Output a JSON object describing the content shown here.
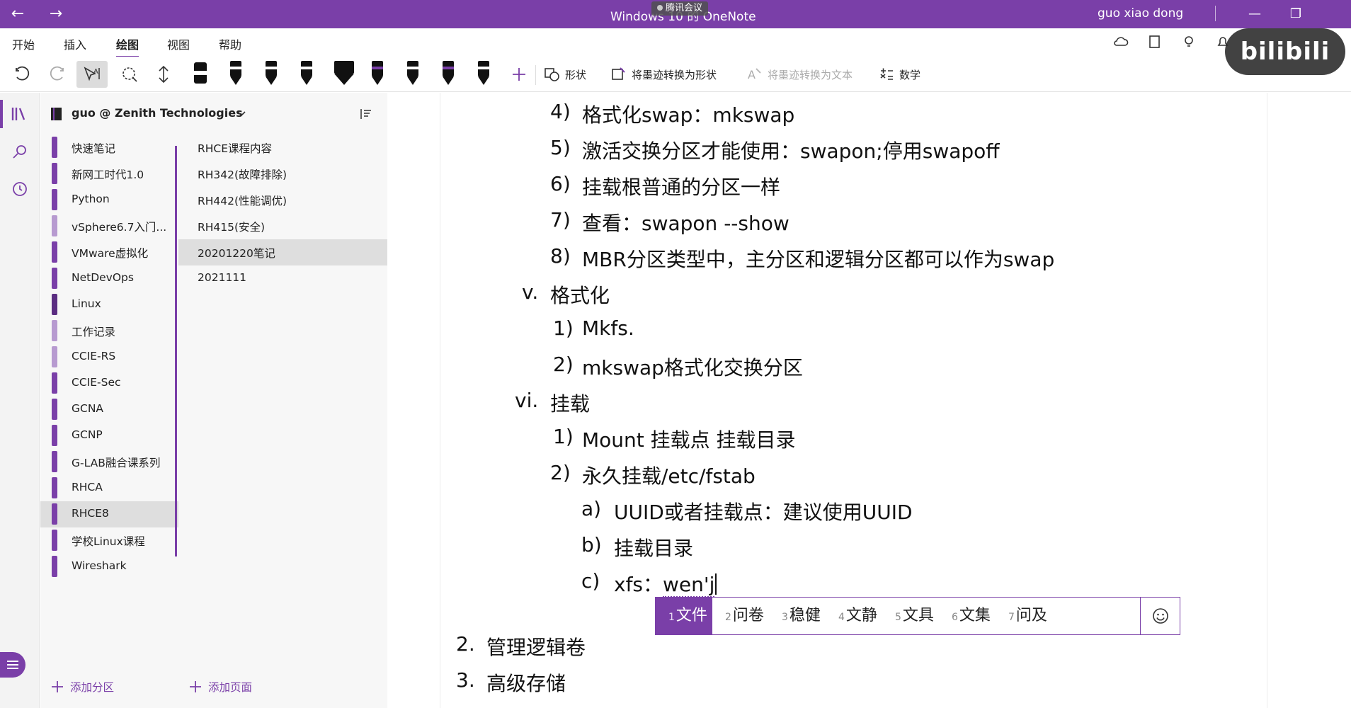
{
  "titlebar": {
    "title": "Windows 10 的 OneNote",
    "meeting_badge": "腾讯会议",
    "user": "guo xiao dong"
  },
  "menu": {
    "tabs": [
      "开始",
      "插入",
      "绘图",
      "视图",
      "帮助"
    ],
    "active_tab": "绘图"
  },
  "toolbar": {
    "shapes_label": "形状",
    "ink_to_shape_label": "将墨迹转换为形状",
    "ink_to_text_label": "将墨迹转换为文本",
    "math_label": "数学",
    "pen_band_colors": [
      "#ffffff",
      "#ffffff",
      "#ffffff",
      "#ffffff",
      "#7a3fa8",
      "#ffffff",
      "#7a3fa8",
      "#ffffff"
    ]
  },
  "notebook": {
    "name": "guo @ Zenith Technologies"
  },
  "sections": {
    "items": [
      {
        "label": "快速笔记",
        "color": "#7a3fa8"
      },
      {
        "label": "新网工时代1.0",
        "color": "#7a3fa8"
      },
      {
        "label": "Python",
        "color": "#7a3fa8"
      },
      {
        "label": "vSphere6.7入门...",
        "color": "#b79ad0"
      },
      {
        "label": "VMware虚拟化",
        "color": "#7a3fa8"
      },
      {
        "label": "NetDevOps",
        "color": "#7a3fa8"
      },
      {
        "label": "Linux",
        "color": "#5b2d82"
      },
      {
        "label": "工作记录",
        "color": "#b79ad0"
      },
      {
        "label": "CCIE-RS",
        "color": "#b79ad0"
      },
      {
        "label": "CCIE-Sec",
        "color": "#7a3fa8"
      },
      {
        "label": "GCNA",
        "color": "#7a3fa8"
      },
      {
        "label": "GCNP",
        "color": "#7a3fa8"
      },
      {
        "label": "G-LAB融合课系列",
        "color": "#7a3fa8"
      },
      {
        "label": "RHCA",
        "color": "#7a3fa8"
      },
      {
        "label": "RHCE8",
        "color": "#7a3fa8"
      },
      {
        "label": "学校Linux课程",
        "color": "#7a3fa8"
      },
      {
        "label": "Wireshark",
        "color": "#7a3fa8"
      }
    ],
    "active": "RHCE8",
    "add_label": "添加分区"
  },
  "pages": {
    "items": [
      "RHCE课程内容",
      "RH342(故障排除)",
      "RH442(性能调优)",
      "RH415(安全)",
      "20201220笔记",
      "2021111"
    ],
    "active": "20201220笔记",
    "add_label": "添加页面"
  },
  "note": {
    "lines": [
      {
        "num": "4)",
        "text": "格式化swap：mkswap"
      },
      {
        "num": "5)",
        "text": "激活交换分区才能使用：swapon;停用swapoff"
      },
      {
        "num": "6)",
        "text": "挂载根普通的分区一样"
      },
      {
        "num": "7)",
        "text": "查看：swapon --show"
      },
      {
        "num": "8)",
        "text": "MBR分区类型中，主分区和逻辑分区都可以作为swap"
      },
      {
        "num": "v.",
        "text": "格式化"
      },
      {
        "num": "1)",
        "text": "Mkfs."
      },
      {
        "num": "2)",
        "text": "mkswap格式化交换分区"
      },
      {
        "num": "vi.",
        "text": "挂载"
      },
      {
        "num": "1)",
        "text": "Mount 挂载点  挂载目录"
      },
      {
        "num": "2)",
        "text": "永久挂载/etc/fstab"
      },
      {
        "num": "a)",
        "text": "UUID或者挂载点：建议使用UUID"
      },
      {
        "num": "b)",
        "text": "挂载目录"
      },
      {
        "num": "c)",
        "text": "xfs：",
        "composing": "wen'j"
      },
      {
        "num": "2.",
        "text": "管理逻辑卷"
      },
      {
        "num": "3.",
        "text": "高级存储"
      }
    ]
  },
  "ime": {
    "candidates": [
      {
        "idx": "1",
        "text": "文件"
      },
      {
        "idx": "2",
        "text": "问卷"
      },
      {
        "idx": "3",
        "text": "稳健"
      },
      {
        "idx": "4",
        "text": "文静"
      },
      {
        "idx": "5",
        "text": "文具"
      },
      {
        "idx": "6",
        "text": "文集"
      },
      {
        "idx": "7",
        "text": "问及"
      }
    ],
    "selected": "1"
  },
  "watermark": {
    "text": "bilibili"
  }
}
